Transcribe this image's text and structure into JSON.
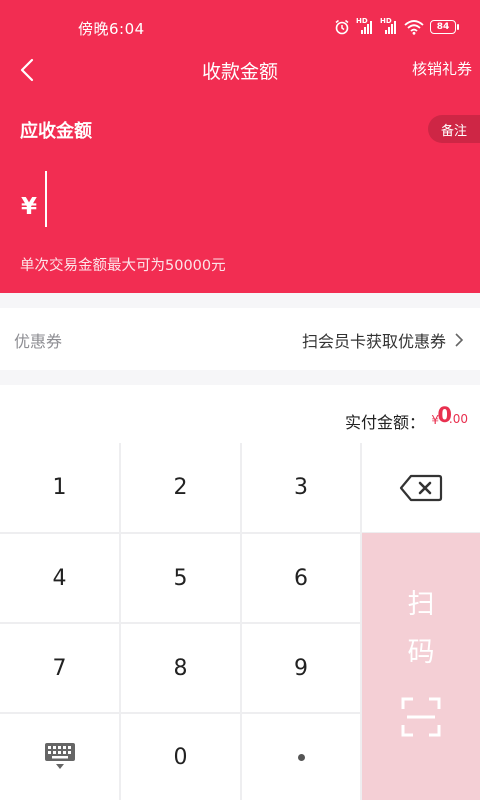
{
  "status_bar": {
    "time": "傍晚6:04",
    "hd1": "HD",
    "hd2": "HD",
    "battery": "84"
  },
  "navbar": {
    "title": "收款金额",
    "right_link": "核销礼券"
  },
  "amount_due": {
    "label": "应收金额",
    "remark_button": "备注",
    "currency_symbol": "¥",
    "limit_note": "单次交易金额最大可为50000元"
  },
  "coupon": {
    "label": "优惠券",
    "link_text": "扫会员卡获取优惠券"
  },
  "payment": {
    "label": "实付金额：",
    "currency_symbol": "¥",
    "integer_part": "0",
    "decimal_part": ".00"
  },
  "keypad": {
    "keys": [
      "1",
      "2",
      "3",
      "4",
      "5",
      "6",
      "7",
      "8",
      "9",
      "0"
    ],
    "scan_label_top": "扫",
    "scan_label_bottom": "码"
  },
  "colors": {
    "brand": "#f22d52",
    "accent_text": "#e8304f",
    "scan_key": "#f4cfd5"
  },
  "icons": [
    "back-icon",
    "alarm-icon",
    "signal-icon",
    "wifi-icon",
    "battery-icon",
    "chevron-right-icon",
    "backspace-icon",
    "keyboard-icon",
    "scan-frame-icon"
  ]
}
